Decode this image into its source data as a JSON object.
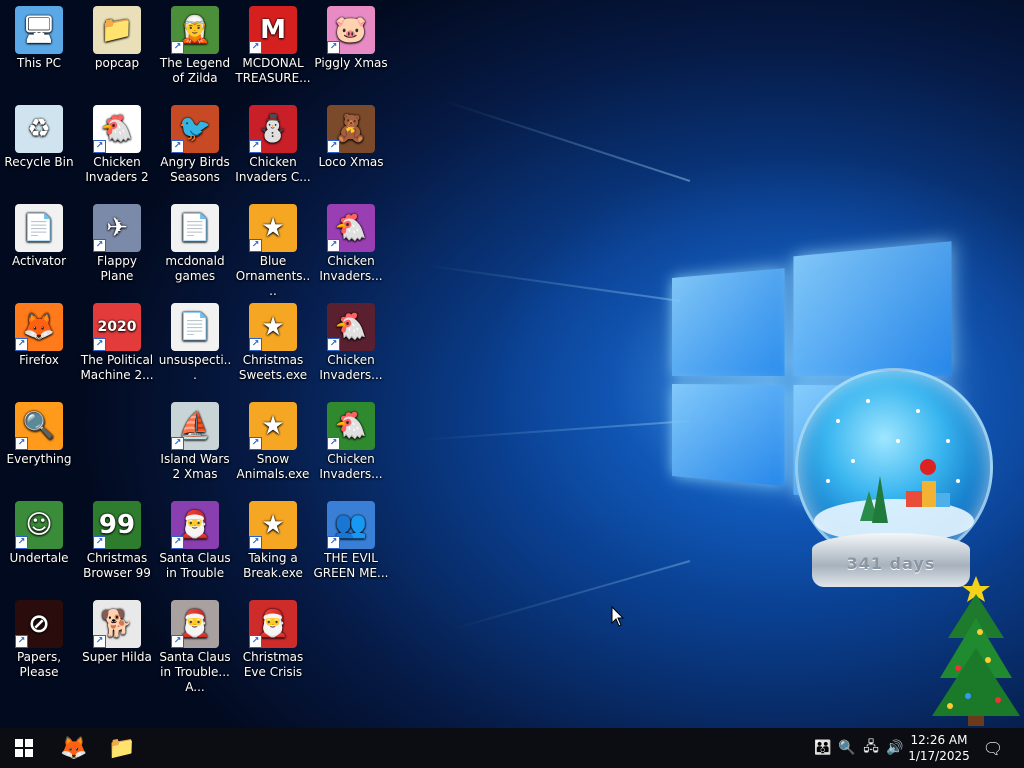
{
  "desktop": {
    "icons": [
      {
        "label": "This PC",
        "glyph": "🖥",
        "color": "#5aa8e6",
        "shortcut": false
      },
      {
        "label": "popcap",
        "glyph": "📁",
        "color": "#e9dfb8",
        "shortcut": false
      },
      {
        "label": "The Legend of Zilda",
        "glyph": "🧝",
        "color": "#4c8f3a",
        "shortcut": true
      },
      {
        "label": "MCDONAL TREASURE...",
        "glyph": "M",
        "color": "#d62020",
        "shortcut": true
      },
      {
        "label": "Piggly Xmas",
        "glyph": "🐷",
        "color": "#e88bc4",
        "shortcut": true
      },
      {
        "label": "Recycle Bin",
        "glyph": "♻",
        "color": "#cfe4ef",
        "shortcut": false
      },
      {
        "label": "Chicken Invaders 2",
        "glyph": "🐔",
        "color": "#ffffff",
        "shortcut": true
      },
      {
        "label": "Angry Birds Seasons",
        "glyph": "🐦",
        "color": "#c84a24",
        "shortcut": true
      },
      {
        "label": "Chicken Invaders C...",
        "glyph": "⛄",
        "color": "#c81f28",
        "shortcut": true
      },
      {
        "label": "Loco Xmas",
        "glyph": "🧸",
        "color": "#7a4a2a",
        "shortcut": true
      },
      {
        "label": "Activator",
        "glyph": "📄",
        "color": "#f2f2f2",
        "shortcut": false
      },
      {
        "label": "Flappy Plane",
        "glyph": "✈",
        "color": "#7b8aa8",
        "shortcut": true
      },
      {
        "label": "mcdonald games",
        "glyph": "📄",
        "color": "#f2f2f2",
        "shortcut": false
      },
      {
        "label": "Blue Ornaments....",
        "glyph": "★",
        "color": "#f5a623",
        "shortcut": true
      },
      {
        "label": "Chicken Invaders...",
        "glyph": "🐔",
        "color": "#9a3fb3",
        "shortcut": true
      },
      {
        "label": "Firefox",
        "glyph": "🦊",
        "color": "#ff7a1a",
        "shortcut": true
      },
      {
        "label": "The Political Machine 2...",
        "glyph": "2020",
        "color": "#e33b3b",
        "shortcut": true
      },
      {
        "label": "unsuspecti...",
        "glyph": "📄",
        "color": "#f2f2f2",
        "shortcut": false
      },
      {
        "label": "Christmas Sweets.exe",
        "glyph": "★",
        "color": "#f5a623",
        "shortcut": true
      },
      {
        "label": "Chicken Invaders...",
        "glyph": "🐔",
        "color": "#5b2030",
        "shortcut": true
      },
      {
        "label": "Everything",
        "glyph": "🔍",
        "color": "#ff9a1a",
        "shortcut": true
      },
      {
        "label": "Island Wars 2 Xmas",
        "glyph": "⛵",
        "color": "#c9d4d6",
        "shortcut": true
      },
      {
        "label": "Snow Animals.exe",
        "glyph": "★",
        "color": "#f5a623",
        "shortcut": true
      },
      {
        "label": "Chicken Invaders...",
        "glyph": "🐔",
        "color": "#2f8a2f",
        "shortcut": true
      },
      {
        "label": "Undertale",
        "glyph": "☺",
        "color": "#3a8c3a",
        "shortcut": true
      },
      {
        "label": "Christmas Browser 99",
        "glyph": "99",
        "color": "#2e7d2e",
        "shortcut": true
      },
      {
        "label": "Santa Claus in Trouble",
        "glyph": "🎅",
        "color": "#8a3fb0",
        "shortcut": true
      },
      {
        "label": "Taking a Break.exe",
        "glyph": "★",
        "color": "#f5a623",
        "shortcut": true
      },
      {
        "label": "THE EVIL GREEN ME...",
        "glyph": "👥",
        "color": "#3a7fd6",
        "shortcut": true
      },
      {
        "label": "Papers, Please",
        "glyph": "⊘",
        "color": "#2a0c0c",
        "shortcut": true
      },
      {
        "label": "Super Hilda",
        "glyph": "🐕",
        "color": "#e9e9e9",
        "shortcut": true
      },
      {
        "label": "Santa Claus in Trouble... A...",
        "glyph": "🎅",
        "color": "#a9a0a0",
        "shortcut": true
      },
      {
        "label": "Christmas Eve Crisis",
        "glyph": "🎅",
        "color": "#ce2b2b",
        "shortcut": true
      }
    ]
  },
  "widget": {
    "days_label": "341 days"
  },
  "taskbar": {
    "start": "⊞",
    "pinned": [
      {
        "name": "firefox",
        "glyph": "🦊"
      },
      {
        "name": "file-explorer",
        "glyph": "📁"
      }
    ],
    "tray": [
      {
        "name": "people",
        "glyph": "👪"
      },
      {
        "name": "search",
        "glyph": "🔍"
      },
      {
        "name": "network",
        "glyph": "🖧"
      },
      {
        "name": "volume",
        "glyph": "🔊"
      }
    ],
    "time": "12:26 AM",
    "date": "1/17/2025",
    "notification": "🗨"
  }
}
